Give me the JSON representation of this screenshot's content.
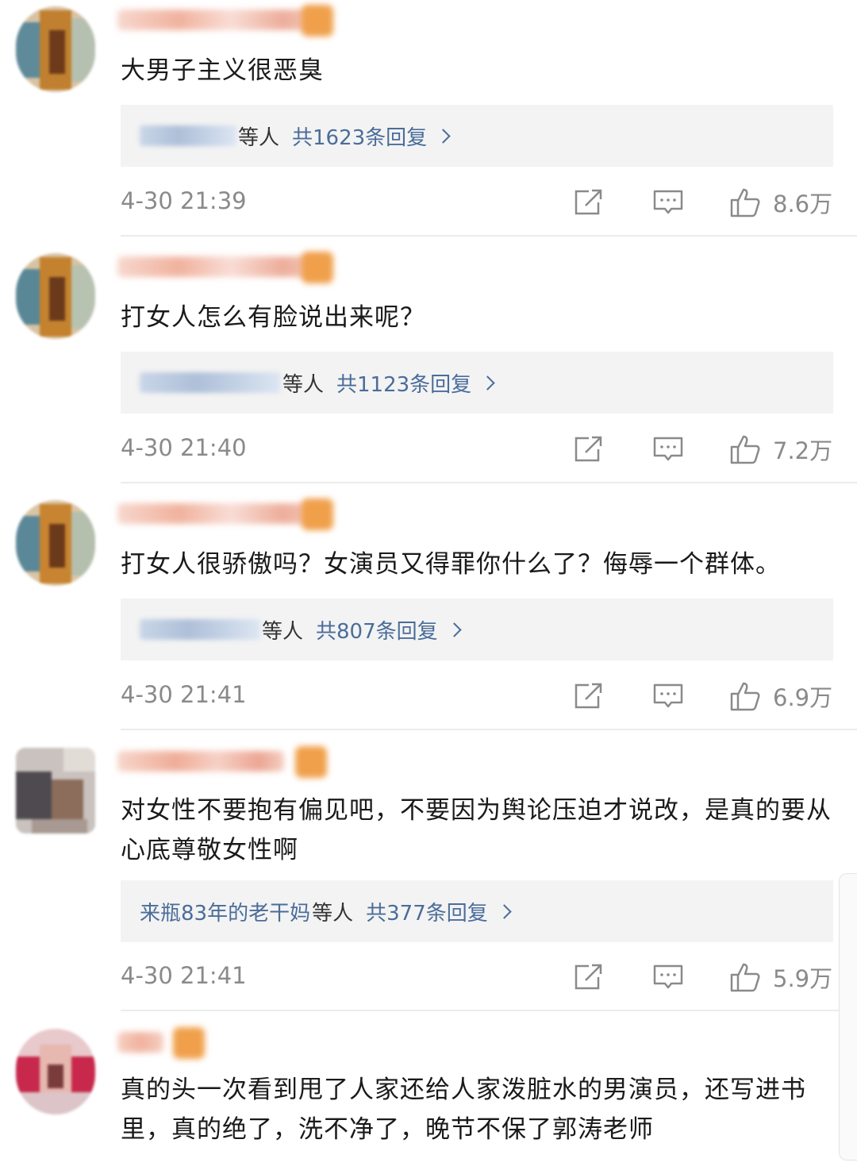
{
  "comments": [
    {
      "text": "大男子主义很恶臭",
      "reply_names": "",
      "reply_suffix": "等人",
      "reply_count": "共1623条回复",
      "time": "4-30 21:39",
      "likes": "8.6万"
    },
    {
      "text": "打女人怎么有脸说出来呢？",
      "reply_names": "",
      "reply_suffix": "等人",
      "reply_count": "共1123条回复",
      "time": "4-30 21:40",
      "likes": "7.2万"
    },
    {
      "text": "打女人很骄傲吗？女演员又得罪你什么了？侮辱一个群体。",
      "reply_names": "",
      "reply_suffix": "等人",
      "reply_count": "共807条回复",
      "time": "4-30 21:41",
      "likes": "6.9万"
    },
    {
      "text": "对女性不要抱有偏见吧，不要因为舆论压迫才说改，是真的要从心底尊敬女性啊",
      "reply_names": "来瓶83年的老干妈",
      "reply_suffix": "等人",
      "reply_count": "共377条回复",
      "time": "4-30 21:41",
      "likes": "5.9万"
    },
    {
      "text": "真的头一次看到甩了人家还给人家泼脏水的男演员，还写进书里，真的绝了，洗不净了，晚节不保了郭涛老师",
      "reply_names": "",
      "reply_suffix": "",
      "reply_count": "",
      "time": "",
      "likes": ""
    }
  ],
  "icons": {
    "share": "share-icon",
    "comment": "comment-icon",
    "like": "thumbs-up-icon",
    "chevron": "chevron-right-icon"
  },
  "colors": {
    "link_blue": "#4a6d9a",
    "meta_gray": "#8a8a8a",
    "reply_bg": "#f3f3f3"
  }
}
